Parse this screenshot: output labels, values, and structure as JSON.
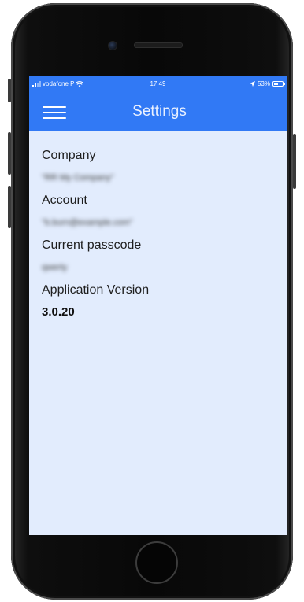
{
  "status_bar": {
    "carrier": "vodafone P",
    "time": "17:49",
    "battery_percent": "53%",
    "battery_level": 0.53
  },
  "header": {
    "title": "Settings",
    "menu_icon": "hamburger-menu-icon"
  },
  "settings": {
    "company_label": "Company",
    "company_value": "\"RR My Company\"",
    "account_label": "Account",
    "account_value": "\"b.burn@example.com\"",
    "passcode_label": "Current passcode",
    "passcode_value": "qwerty",
    "version_label": "Application Version",
    "version_value": "3.0.20"
  },
  "colors": {
    "header_bg": "#3179f5",
    "screen_bg": "#e2ecfd",
    "text": "#1e1e1e"
  }
}
